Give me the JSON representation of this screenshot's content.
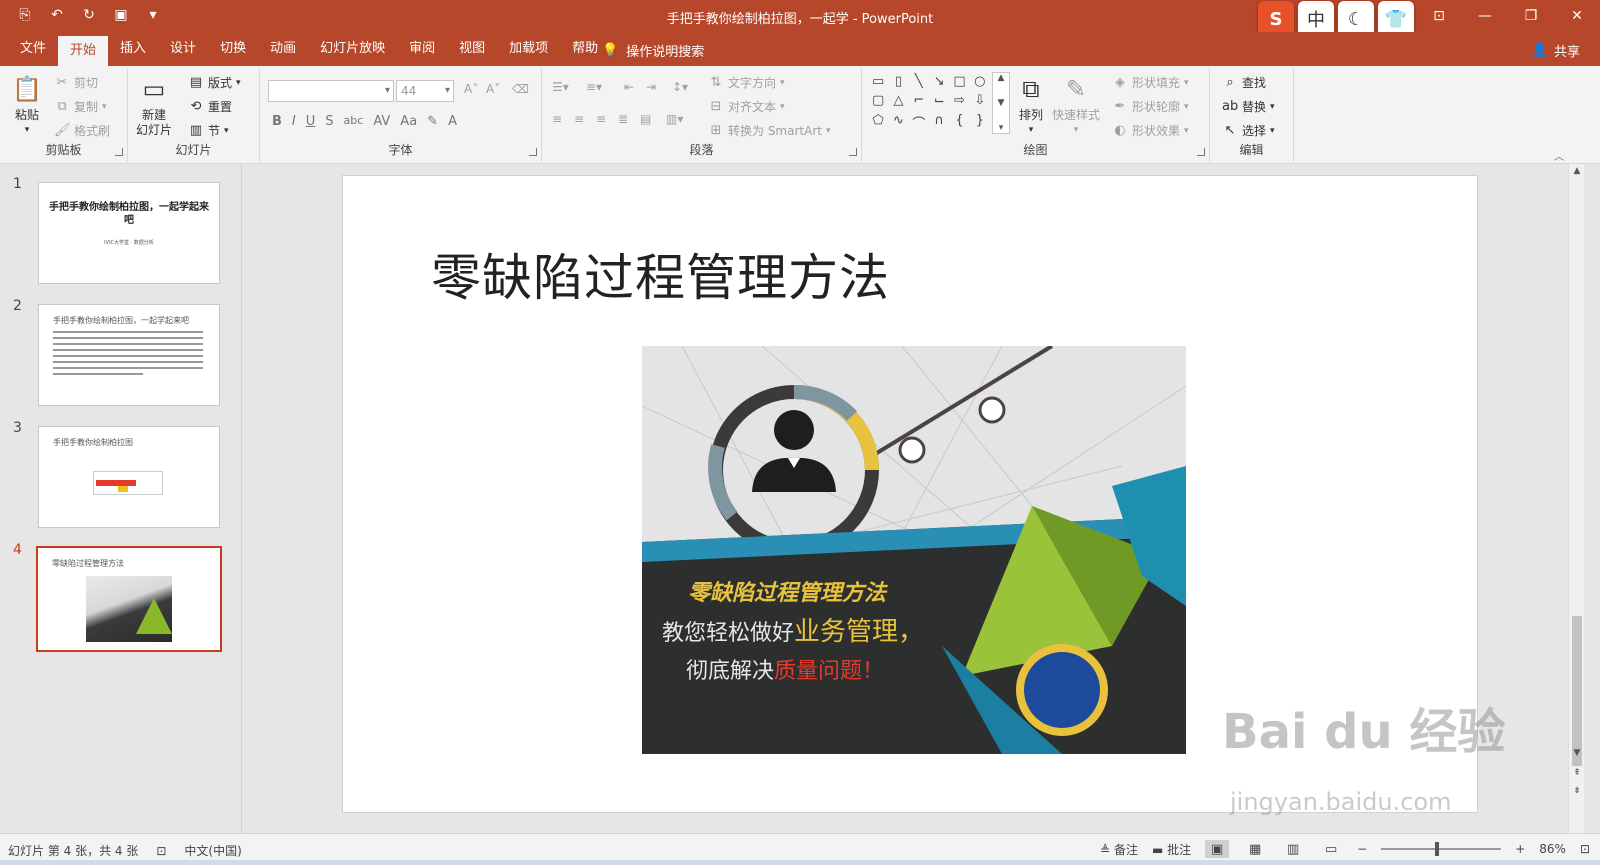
{
  "window": {
    "title": "手把手教你绘制柏拉图，一起学 - PowerPoint",
    "qat": [
      "save-icon",
      "undo-icon",
      "redo-icon",
      "present-icon",
      "customize-icon"
    ],
    "ime": [
      "S",
      "中",
      "☾",
      "👕"
    ],
    "controls": [
      "restore-ribbon-icon",
      "minimize-icon",
      "maximize-icon",
      "close-icon"
    ]
  },
  "ribbon_tabs": {
    "items": [
      "文件",
      "开始",
      "插入",
      "设计",
      "切换",
      "动画",
      "幻灯片放映",
      "审阅",
      "视图",
      "加载项",
      "帮助"
    ],
    "active": "开始",
    "tellme": "操作说明搜索",
    "share": "共享"
  },
  "groups": {
    "clipboard": {
      "label": "剪贴板",
      "paste": "粘贴",
      "cut": "剪切",
      "copy": "复制",
      "painter": "格式刷"
    },
    "slides": {
      "label": "幻灯片",
      "new_slide_1": "新建",
      "new_slide_2": "幻灯片",
      "layout": "版式",
      "reset": "重置",
      "section": "节"
    },
    "font": {
      "label": "字体",
      "font_name": "",
      "font_size": "44",
      "fmt": [
        "B",
        "I",
        "U",
        "S",
        "abc",
        "AV",
        "Aa",
        "A"
      ]
    },
    "paragraph": {
      "label": "段落",
      "text_direction": "文字方向",
      "align_text": "对齐文本",
      "smartart": "转换为 SmartArt"
    },
    "drawing": {
      "label": "绘图",
      "arrange": "排列",
      "quick_styles": "快速样式",
      "fill": "形状填充",
      "outline": "形状轮廓",
      "effects": "形状效果"
    },
    "editing": {
      "label": "编辑",
      "find": "查找",
      "replace": "替换",
      "select": "选择"
    }
  },
  "thumbnails": [
    {
      "num": "1",
      "title": "手把手教你绘制柏拉图，一起学起来吧",
      "sub": "IVIC大学堂 · 数据分析"
    },
    {
      "num": "2",
      "title": "手把手教你绘制柏拉图，一起学起来吧"
    },
    {
      "num": "3",
      "title": "手把手教你绘制柏拉图"
    },
    {
      "num": "4",
      "title": "零缺陷过程管理方法",
      "active": true
    }
  ],
  "slide": {
    "title": "零缺陷过程管理方法",
    "image": {
      "headline": "零缺陷过程管理方法",
      "line1_a": "教您轻松做好",
      "line1_b": "业务管理，",
      "line2_a": "彻底解决",
      "line2_b": "质量问题！"
    }
  },
  "watermark": {
    "text": "Bai du 经验",
    "url": "jingyan.baidu.com"
  },
  "status": {
    "slide_info": "幻灯片 第 4 张，共 4 张",
    "language": "中文(中国)",
    "notes": "备注",
    "comments": "批注",
    "zoom": "86%"
  },
  "colors": {
    "accent": "#b7472a",
    "active_thumb": "#c43e1c"
  }
}
